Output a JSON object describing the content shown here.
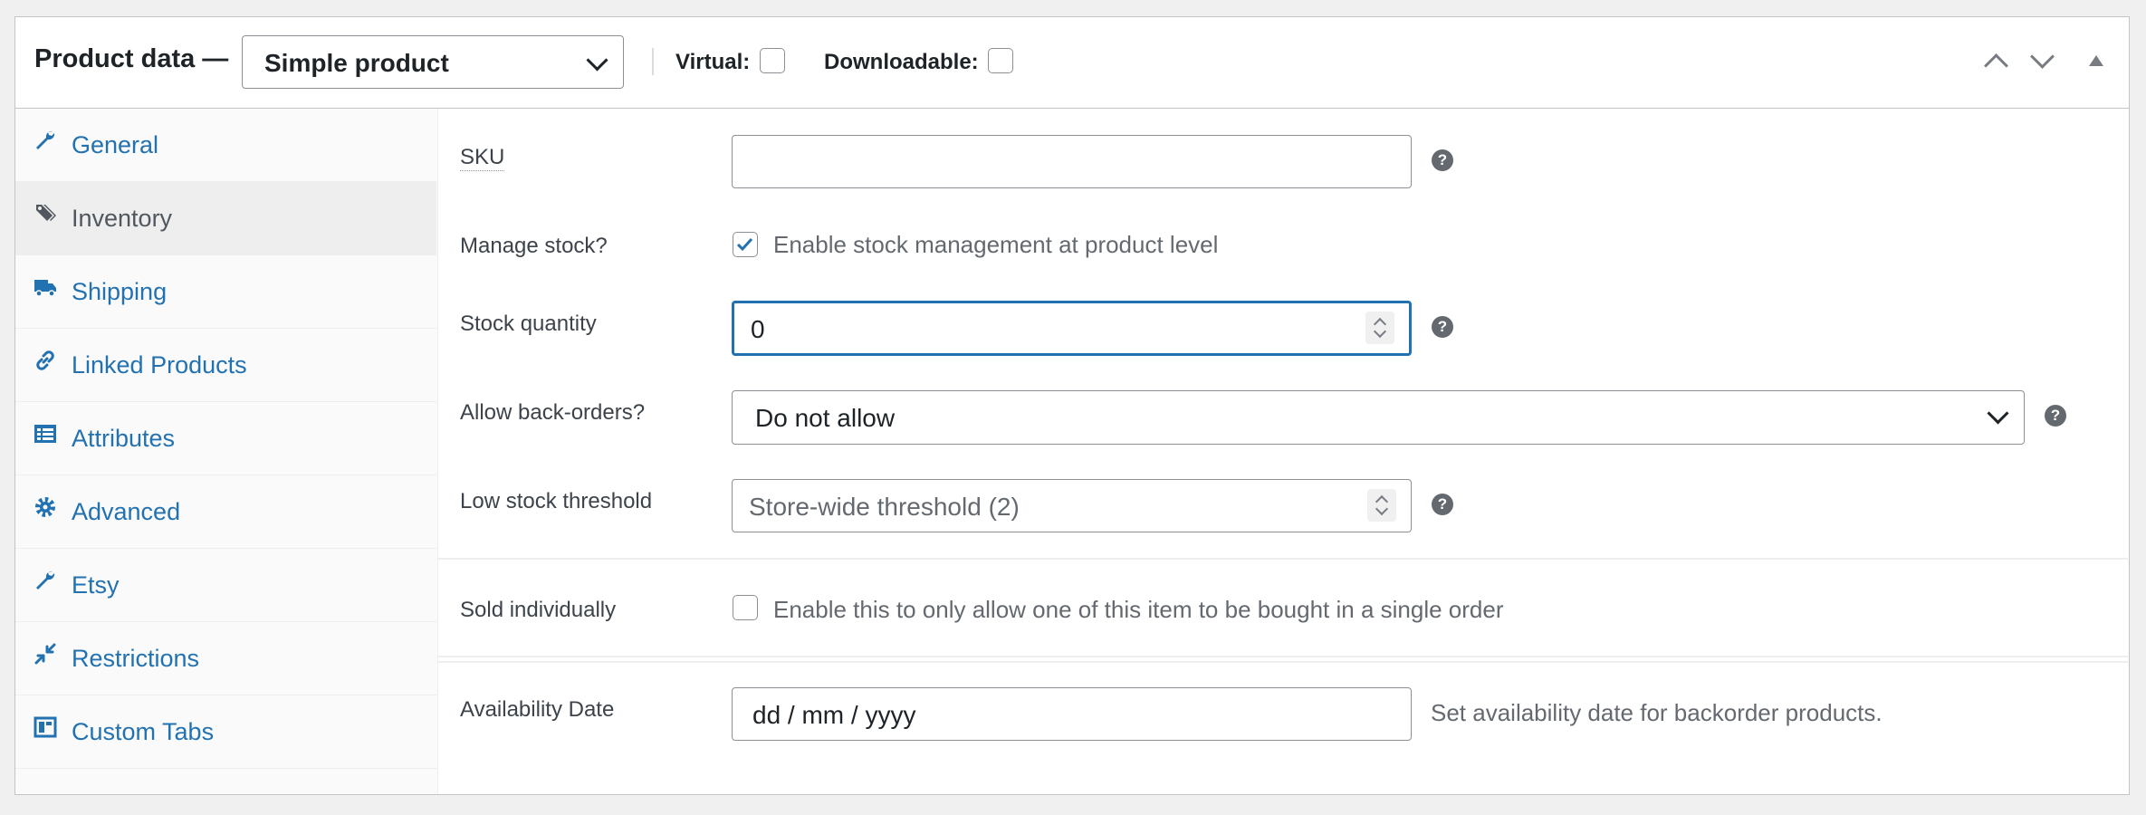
{
  "header": {
    "title": "Product data —",
    "product_type": "Simple product",
    "virtual_label": "Virtual:",
    "virtual_checked": false,
    "downloadable_label": "Downloadable:",
    "downloadable_checked": false
  },
  "sidebar": {
    "items": [
      {
        "label": "General",
        "icon": "wrench-icon"
      },
      {
        "label": "Inventory",
        "icon": "tag-icon",
        "active": true
      },
      {
        "label": "Shipping",
        "icon": "truck-icon"
      },
      {
        "label": "Linked Products",
        "icon": "link-icon"
      },
      {
        "label": "Attributes",
        "icon": "list-icon"
      },
      {
        "label": "Advanced",
        "icon": "gear-icon"
      },
      {
        "label": "Etsy",
        "icon": "wrench-icon"
      },
      {
        "label": "Restrictions",
        "icon": "shrink-icon"
      },
      {
        "label": "Custom Tabs",
        "icon": "tabs-icon"
      }
    ]
  },
  "inventory": {
    "sku_label": "SKU",
    "sku_value": "",
    "manage_stock_label": "Manage stock?",
    "manage_stock_text": "Enable stock management at product level",
    "manage_stock_checked": true,
    "stock_qty_label": "Stock quantity",
    "stock_qty_value": "0",
    "backorders_label": "Allow back-orders?",
    "backorders_value": "Do not allow",
    "low_stock_label": "Low stock threshold",
    "low_stock_placeholder": "Store-wide threshold (2)",
    "sold_individually_label": "Sold individually",
    "sold_individually_text": "Enable this to only allow one of this item to be bought in a single order",
    "sold_individually_checked": false,
    "availability_label": "Availability Date",
    "availability_placeholder": "dd / mm / yyyy",
    "availability_help": "Set availability date for backorder products."
  },
  "colors": {
    "link": "#2271b1",
    "focus": "#2271b1",
    "active_tab_bg": "#eeeeee"
  }
}
